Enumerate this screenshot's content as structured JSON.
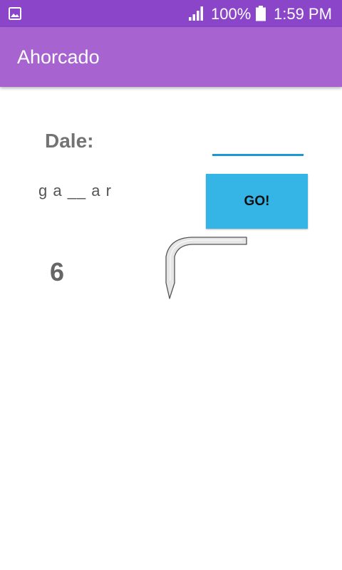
{
  "status_bar": {
    "battery_percent": "100%",
    "time": "1:59 PM",
    "icons": [
      "image-icon",
      "signal-icon",
      "battery-icon"
    ]
  },
  "app_bar": {
    "title": "Ahorcado",
    "color": "#a764d0"
  },
  "game": {
    "prompt_label": "Dale:",
    "guess_input_value": "",
    "word_display": "g a __ a r",
    "go_button_label": "GO!",
    "remaining_attempts": "6"
  },
  "colors": {
    "status_bar": "#8a45c9",
    "accent": "#1f97d3",
    "button": "#34b5e6"
  }
}
